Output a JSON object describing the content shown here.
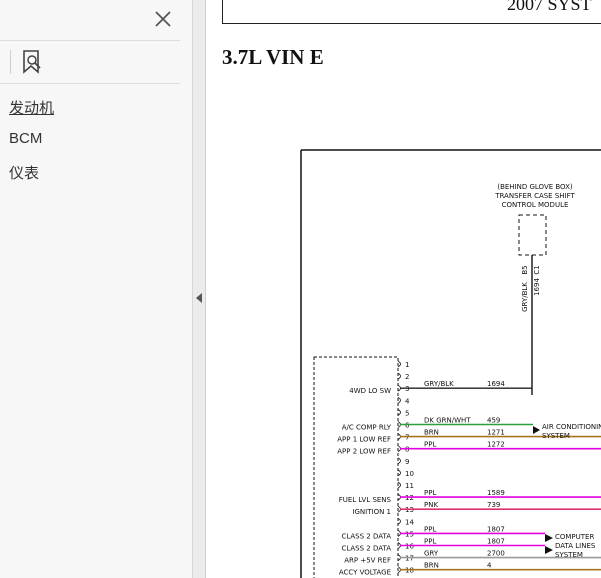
{
  "sidebar": {
    "close_tooltip": "Close",
    "bookmarks": [
      {
        "label": "发动机",
        "active": true
      },
      {
        "label": "BCM",
        "active": false
      },
      {
        "label": "仪表",
        "active": false
      }
    ]
  },
  "document": {
    "header_text": "2007 SYST",
    "section_title": "3.7L VIN E",
    "module": {
      "line1": "(BEHIND GLOVE BOX)",
      "line2": "TRANSFER CASE SHIFT",
      "line3": "CONTROL MODULE",
      "pin_label_b": "B5",
      "pin_label_c": "C1",
      "wire_color": "GRY/BLK",
      "circuit": "1694"
    },
    "ecm_pins": [
      {
        "num": "1",
        "label": "",
        "color": "",
        "circuit": ""
      },
      {
        "num": "2",
        "label": "",
        "color": "",
        "circuit": ""
      },
      {
        "num": "3",
        "label": "4WD LO SW",
        "color": "GRY/BLK",
        "circuit": "1694"
      },
      {
        "num": "4",
        "label": "",
        "color": "",
        "circuit": ""
      },
      {
        "num": "5",
        "label": "",
        "color": "",
        "circuit": ""
      },
      {
        "num": "6",
        "label": "A/C COMP RLY",
        "color": "DK GRN/WHT",
        "circuit": "459"
      },
      {
        "num": "7",
        "label": "APP 1 LOW REF",
        "color": "BRN",
        "circuit": "1271"
      },
      {
        "num": "8",
        "label": "APP 2 LOW REF",
        "color": "PPL",
        "circuit": "1272"
      },
      {
        "num": "9",
        "label": "",
        "color": "",
        "circuit": ""
      },
      {
        "num": "10",
        "label": "",
        "color": "",
        "circuit": ""
      },
      {
        "num": "11",
        "label": "",
        "color": "",
        "circuit": ""
      },
      {
        "num": "12",
        "label": "FUEL LVL SENS",
        "color": "PPL",
        "circuit": "1589"
      },
      {
        "num": "13",
        "label": "IGNITION 1",
        "color": "PNK",
        "circuit": "739"
      },
      {
        "num": "14",
        "label": "",
        "color": "",
        "circuit": ""
      },
      {
        "num": "15",
        "label": "CLASS 2 DATA",
        "color": "PPL",
        "circuit": "1807"
      },
      {
        "num": "16",
        "label": "CLASS 2 DATA",
        "color": "PPL",
        "circuit": "1807"
      },
      {
        "num": "17",
        "label": "ARP +5V REF",
        "color": "GRY",
        "circuit": "2700"
      },
      {
        "num": "18",
        "label": "ACCY VOLTAGE",
        "color": "BRN",
        "circuit": "4"
      }
    ],
    "arrow_labels": {
      "ac_line1": "AIR CONDITIONIN",
      "ac_line2": "SYSTEM",
      "cd_line1": "COMPUTER",
      "cd_line2": "DATA LINES",
      "cd_line3": "SYSTEM"
    },
    "wire_colors": {
      "grn": "#2e9e3a",
      "brn": "#a8741b",
      "ppl": "#e000e0",
      "pnk": "#e0306a",
      "gry": "#9a9a9a",
      "blk": "#222222"
    }
  }
}
